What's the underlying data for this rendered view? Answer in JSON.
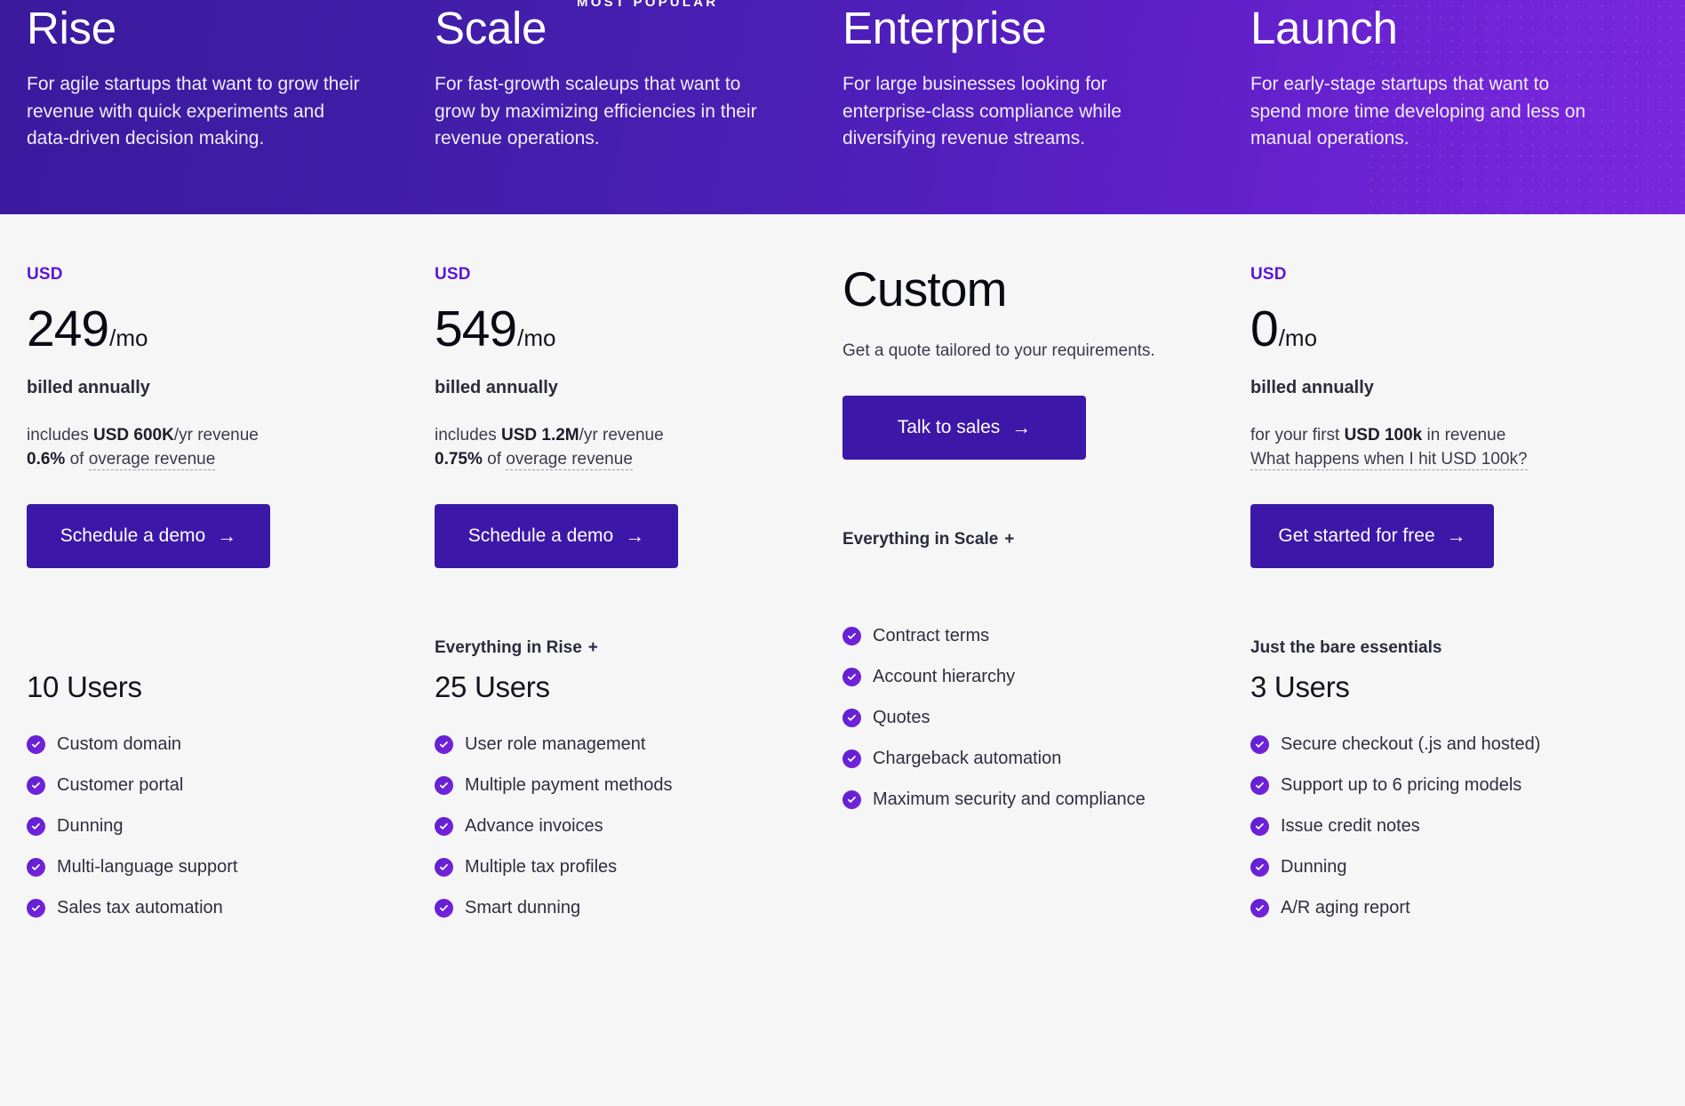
{
  "theme": {
    "banner_gradient_start": "#3b1a9e",
    "banner_gradient_end": "#7b27dd",
    "page_background": "#f6f6f7",
    "accent_purple": "#5b16d6",
    "button_purple": "#3d17a8",
    "check_icon_purple": "#6a21d6"
  },
  "badge": {
    "most_popular": "MOST POPULAR"
  },
  "plans": [
    {
      "name": "Rise",
      "description": "For agile startups that want to grow their revenue with quick experiments and data-driven decision making.",
      "currency": "USD",
      "price_amount": "249",
      "price_per": "/mo",
      "billing_note": "billed annually",
      "includes_prefix": "includes ",
      "includes_bold": "USD 600K",
      "includes_suffix": "/yr revenue",
      "overage_percent": "0.6%",
      "overage_mid": " of ",
      "overage_link": "overage revenue",
      "cta_label": "Schedule a demo",
      "cta_arrow": "→",
      "features_head": "",
      "features_plus": "",
      "users_count": "10 Users",
      "features": [
        "Custom domain",
        "Customer portal",
        "Dunning",
        "Multi-language support",
        "Sales tax automation"
      ]
    },
    {
      "name": "Scale",
      "description": "For fast-growth scaleups that want to grow by maximizing efficiencies in their revenue operations.",
      "currency": "USD",
      "price_amount": "549",
      "price_per": "/mo",
      "billing_note": "billed annually",
      "includes_prefix": "includes ",
      "includes_bold": "USD 1.2M",
      "includes_suffix": "/yr revenue",
      "overage_percent": "0.75%",
      "overage_mid": " of ",
      "overage_link": "overage revenue",
      "cta_label": "Schedule a demo",
      "cta_arrow": "→",
      "features_head": "Everything in Rise",
      "features_plus": "+",
      "users_count": "25 Users",
      "features": [
        "User role management",
        "Multiple payment methods",
        "Advance invoices",
        "Multiple tax profiles",
        "Smart dunning"
      ]
    },
    {
      "name": "Enterprise",
      "description": "For large businesses looking for enterprise-class compliance while diversifying revenue streams.",
      "currency": "",
      "price_custom": "Custom",
      "billing_note": "",
      "quote_text": "Get a quote tailored to your requirements.",
      "cta_label": "Talk to sales",
      "cta_arrow": "→",
      "features_head": "Everything in Scale",
      "features_plus": "+",
      "users_count": "",
      "features": [
        "Contract terms",
        "Account hierarchy",
        "Quotes",
        "Chargeback automation",
        "Maximum security and compliance"
      ]
    },
    {
      "name": "Launch",
      "description": "For early-stage startups that want to spend more time developing and less on manual operations.",
      "currency": "USD",
      "price_amount": "0",
      "price_per": "/mo",
      "billing_note": "billed annually",
      "includes_prefix": "for your first ",
      "includes_bold": "USD 100k",
      "includes_suffix": " in revenue",
      "overage_link": "What happens when I hit USD 100k?",
      "cta_label": "Get started for free",
      "cta_arrow": "→",
      "features_head": "Just the bare essentials",
      "features_plus": "",
      "users_count": "3 Users",
      "features": [
        "Secure checkout (.js and hosted)",
        "Support up to 6 pricing models",
        "Issue credit notes",
        "Dunning",
        "A/R aging report"
      ]
    }
  ]
}
